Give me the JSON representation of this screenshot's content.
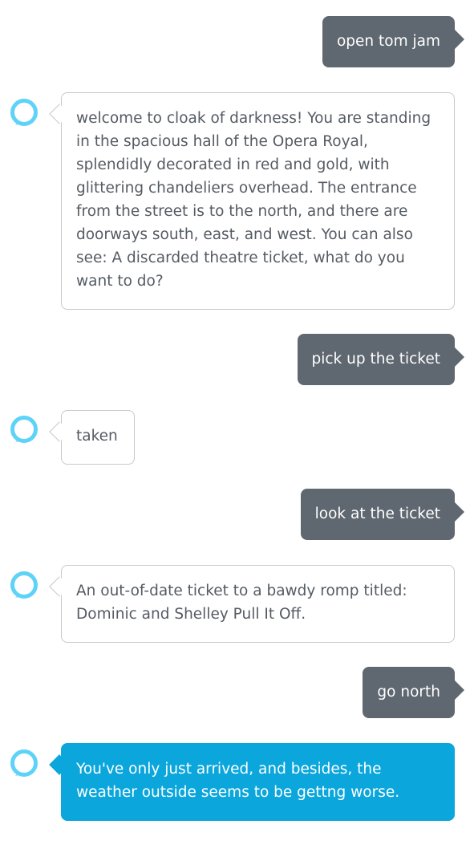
{
  "conversation": {
    "messages": [
      {
        "role": "user",
        "text": "open tom jam"
      },
      {
        "role": "alexa",
        "text": "welcome to cloak of darkness! You are standing in the spacious hall of the Opera Royal, splendidly decorated in red and gold, with glittering chandeliers overhead. The entrance from the street is to the north, and there are doorways south, east, and west. You can also see: A discarded theatre ticket, what do you want to do?"
      },
      {
        "role": "user",
        "text": "pick up the ticket"
      },
      {
        "role": "alexa",
        "text": "taken"
      },
      {
        "role": "user",
        "text": "look at the ticket"
      },
      {
        "role": "alexa",
        "text": "An out-of-date ticket to a bawdy romp titled: Dominic and Shelley Pull It Off."
      },
      {
        "role": "user",
        "text": "go north"
      },
      {
        "role": "alexa",
        "text": "You've only just arrived, and besides, the weather outside seems to be gettng worse."
      }
    ]
  },
  "icons": {
    "avatar": "alexa-ring-icon"
  },
  "colors": {
    "user_bubble": "#5f6770",
    "alexa_bubble_border": "#c5c9ce",
    "alexa_text": "#555b63",
    "latest_response_bubble": "#0aa6dc",
    "alexa_ring": "#5fd3f7"
  }
}
